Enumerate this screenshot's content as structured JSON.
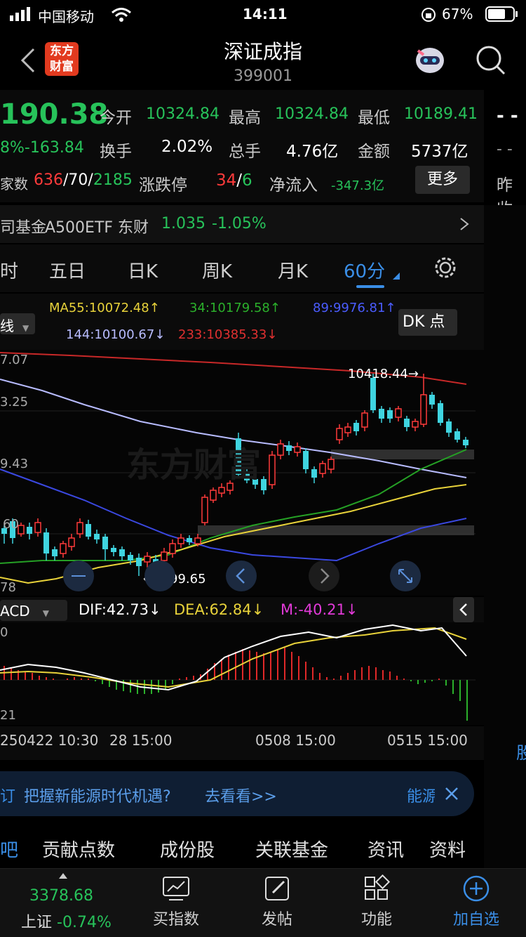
{
  "status": {
    "carrier": "中国移动",
    "time": "14:11",
    "battery": "67%"
  },
  "header": {
    "title": "深证成指",
    "code": "399001",
    "logo_top": "东方",
    "logo_bottom": "财富"
  },
  "quote": {
    "price": "190.38",
    "change": "8%-163.84",
    "open_label": "今开",
    "open": "10324.84",
    "high_label": "最高",
    "high": "10324.84",
    "low_label": "最低",
    "low": "10189.41",
    "turnover_label": "换手",
    "turnover": "2.02%",
    "volume_label": "总手",
    "volume": "4.76亿",
    "amount_label": "金额",
    "amount": "5737亿",
    "count_label": "家数",
    "up": "636",
    "flat": "/70/",
    "down": "2185",
    "limit_label": "涨跌停",
    "limit_up": "34",
    "limit_sep": "/",
    "limit_down": "6",
    "inflow_label": "净流入",
    "inflow": "-347.3亿",
    "more": "更多",
    "side_dash": "- -",
    "side_dash2": "- -",
    "side_prev": "昨收"
  },
  "fund_bar": {
    "prefix": "司基金",
    "name": "A500ETF 东财",
    "price": "1.035",
    "change": "-1.05%"
  },
  "tabs": [
    "时",
    "五日",
    "日K",
    "周K",
    "月K",
    "60分"
  ],
  "ma": {
    "ma55": "MA55:10072.48",
    "ma55_arrow": "↑",
    "ma34": "34:10179.58",
    "ma34_arrow": "↑",
    "ma89": "89:9976.81",
    "ma89_arrow": "↑",
    "ma144": "144:10100.67",
    "ma144_arrow": "↓",
    "ma233": "233:10385.33",
    "ma233_arrow": "↓",
    "line_select": "线",
    "dk": "DK 点"
  },
  "chart_labels": {
    "y1": "7.07",
    "y2": "3.25",
    "y3": "9.43",
    "y4": "60",
    "y5": "78",
    "max_label": "10418.44→",
    "min_label": "←9799.65",
    "watermark": "东方财富"
  },
  "macd": {
    "select": "ACD",
    "dif": "DIF:42.73",
    "dif_arrow": "↓",
    "dea": "DEA:62.84",
    "dea_arrow": "↓",
    "m": "M:-40.21",
    "m_arrow": "↓",
    "y1": "0",
    "y2": "21"
  },
  "time_axis": [
    "250422 10:30",
    "28 15:00",
    "0508 15:00",
    "0515 15:00"
  ],
  "side_right": {
    "label": "股"
  },
  "banner": {
    "prefix": "订",
    "text": "把握新能源时代机遇?",
    "link": "去看看>>",
    "right": "能源"
  },
  "info_tabs": [
    "吧",
    "贡献点数",
    "成份股",
    "关联基金",
    "资讯",
    "资料"
  ],
  "bottom": {
    "index_value": "3378.68",
    "index_name": "上证",
    "index_change": "-0.74%",
    "items": [
      "买指数",
      "发帖",
      "功能",
      "加自选"
    ]
  },
  "colors": {
    "up": "#ff3b3b",
    "down": "#27c25a",
    "accent": "#3a8ee6",
    "ma55": "#e8d23a",
    "ma34": "#2bb02b",
    "ma89": "#4a5cff",
    "ma144": "#b8bcff",
    "ma233": "#e03030"
  },
  "chart_data": {
    "type": "candlestick",
    "title": "",
    "series": [
      {
        "name": "MA233",
        "values": [
          10420,
          10400,
          10385
        ]
      },
      {
        "name": "MA144",
        "values": [
          10380,
          10200,
          10100
        ]
      }
    ],
    "ylim": [
      9780,
      10430
    ],
    "max": 10418.44,
    "min": 9799.65
  }
}
